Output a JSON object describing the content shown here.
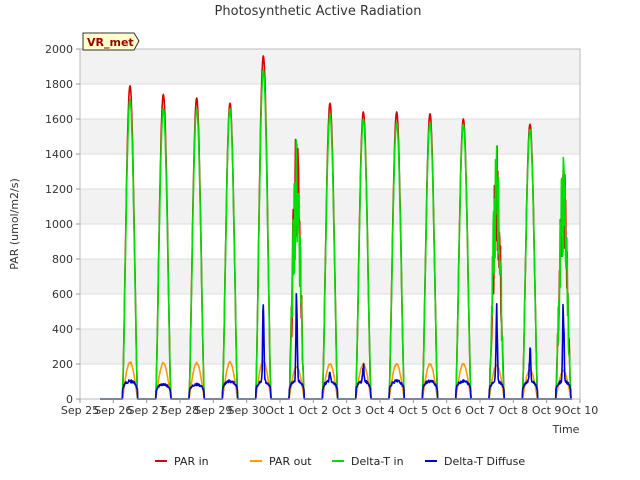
{
  "chart_data": {
    "type": "line",
    "title": "Photosynthetic Active Radiation",
    "xlabel": "Time",
    "ylabel": "PAR (umol/m2/s)",
    "station_label": "VR_met",
    "ylim": [
      0,
      2000
    ],
    "yticks": [
      0,
      200,
      400,
      600,
      800,
      1000,
      1200,
      1400,
      1600,
      1800,
      2000
    ],
    "xlim": [
      "Sep 25",
      "Oct 10"
    ],
    "xticks": [
      "Sep 25",
      "Sep 26",
      "Sep 27",
      "Sep 28",
      "Sep 29",
      "Sep 30",
      "Oct 1",
      "Oct 2",
      "Oct 3",
      "Oct 4",
      "Oct 5",
      "Oct 6",
      "Oct 7",
      "Oct 8",
      "Oct 9",
      "Oct 10"
    ],
    "grid": true,
    "legend_position": "bottom",
    "days": [
      "Sep 26",
      "Sep 27",
      "Sep 28",
      "Sep 29",
      "Sep 30",
      "Oct 1",
      "Oct 2",
      "Oct 3",
      "Oct 4",
      "Oct 5",
      "Oct 6",
      "Oct 7",
      "Oct 8",
      "Oct 9"
    ],
    "series": [
      {
        "name": "PAR in",
        "color": "#dd0000",
        "daily_peak": [
          1790,
          1740,
          1720,
          1690,
          1960,
          1600,
          1690,
          1640,
          1640,
          1630,
          1600,
          1470,
          1570,
          1470
        ]
      },
      {
        "name": "PAR out",
        "color": "#ff9900",
        "daily_peak": [
          215,
          210,
          210,
          215,
          220,
          190,
          205,
          205,
          205,
          205,
          205,
          200,
          170,
          165
        ]
      },
      {
        "name": "Delta-T in",
        "color": "#00dd00",
        "daily_peak": [
          1710,
          1660,
          1660,
          1660,
          1880,
          1520,
          1630,
          1600,
          1580,
          1580,
          1570,
          1500,
          1540,
          1430
        ]
      },
      {
        "name": "Delta-T Diffuse",
        "color": "#0000cc",
        "daily_peak": [
          150,
          90,
          90,
          110,
          690,
          740,
          180,
          235,
          110,
          120,
          125,
          660,
          340,
          710
        ]
      }
    ]
  }
}
